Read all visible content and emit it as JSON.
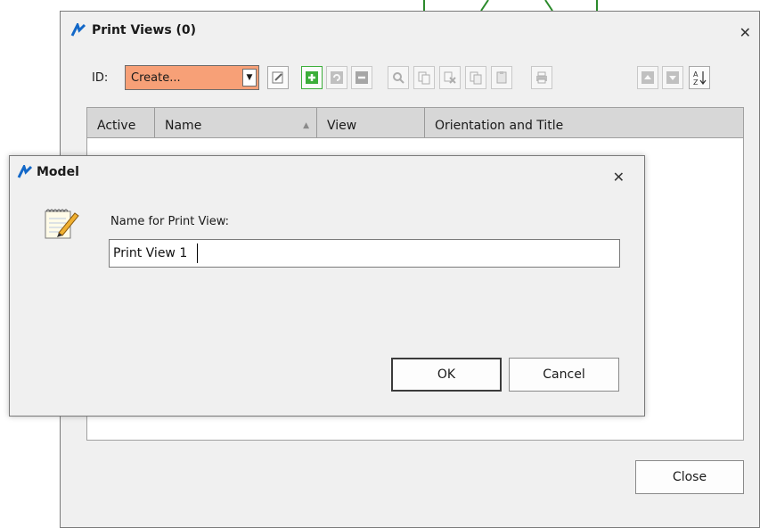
{
  "print_views": {
    "title": "Print Views (0)",
    "id_label": "ID:",
    "id_value": "Create...",
    "columns": [
      "Active",
      "Name",
      "View",
      "Orientation and Title"
    ],
    "close_label": "Close"
  },
  "model": {
    "title": "Model",
    "prompt": "Name for Print View:",
    "name_value": "Print View 1",
    "ok_label": "OK",
    "cancel_label": "Cancel"
  },
  "colors": {
    "combo_highlight": "#f7a077",
    "logo_blue": "#1368c8",
    "add_green": "#3cae3a"
  },
  "icons": {
    "toolbar": [
      "edit-icon",
      "add-icon",
      "refresh-icon",
      "remove-icon",
      "zoom-icon",
      "copy-icon",
      "delete-copy-icon",
      "duplicate-icon",
      "paste-icon",
      "print-icon",
      "move-up-icon",
      "move-down-icon",
      "sort-az-icon"
    ]
  }
}
